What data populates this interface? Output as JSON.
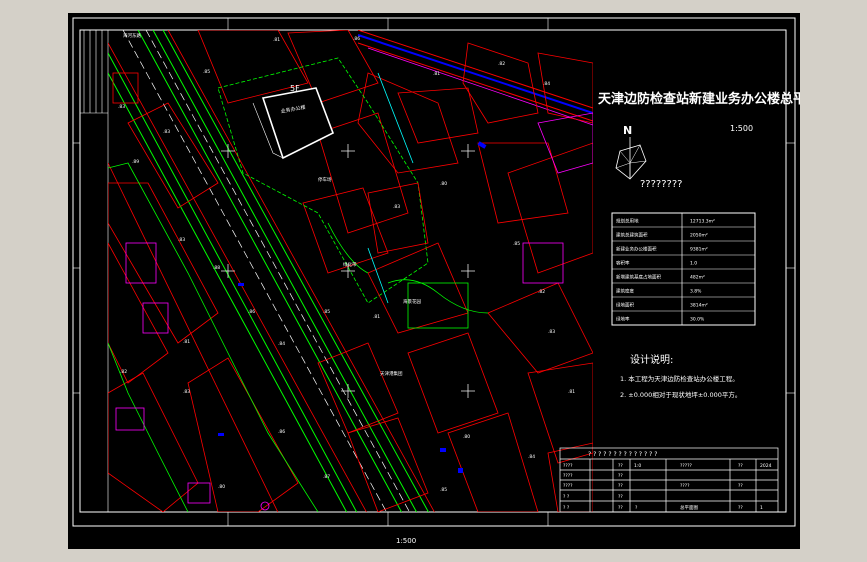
{
  "drawing": {
    "title": "天津边防检查站新建业务办公楼总平面图",
    "north_label": "N",
    "scale_label": "1:500",
    "bottom_scale": "1:500",
    "compass_caption": "????????",
    "building_floor_label": "5F",
    "building_label": "业务办公楼",
    "table": [
      {
        "label": "规划总用地",
        "value": "12713.3m²"
      },
      {
        "label": "建筑总建筑面积",
        "value": "2050m²"
      },
      {
        "label": "新建业务办公楼面积",
        "value": "9381m²"
      },
      {
        "label": "容积率",
        "value": "1.0"
      },
      {
        "label": "新增建筑基底占地面积",
        "value": "482m²"
      },
      {
        "label": "建筑密度",
        "value": "3.8%"
      },
      {
        "label": "绿地面积",
        "value": "3814m²"
      },
      {
        "label": "绿地率",
        "value": "30.0%"
      }
    ],
    "notes_title": "设计说明:",
    "notes": [
      "1. 本工程为天津边防检查站办公楼工程。",
      "2. ±0.000相对于现状地坪±0.000平方。"
    ],
    "title_block": {
      "header": "? ? ? ? ? ? ? ? ? ? ? ? ? ?",
      "r1": [
        "????",
        "??",
        "1:0",
        "?????",
        "??",
        "2024"
      ],
      "r2": [
        "????",
        "??"
      ],
      "r3": [
        "????",
        "??",
        "????",
        "??"
      ],
      "r4": [
        "? ?",
        "??"
      ],
      "r5": [
        "? ?",
        "??",
        "?",
        "总平面图",
        "??",
        "1"
      ]
    },
    "map_labels": {
      "road_main": "海河东路",
      "building_a": "海景花园",
      "building_b": "天津港集团",
      "greenery": "绿化带",
      "parking": "停车场"
    }
  },
  "colors": {
    "background": "#000000",
    "frame": "#ffffff",
    "red_lines": "#ff0000",
    "green_lines": "#00ff00",
    "blue_lines": "#0000ff",
    "magenta": "#ff00ff",
    "cyan": "#00ffff"
  }
}
